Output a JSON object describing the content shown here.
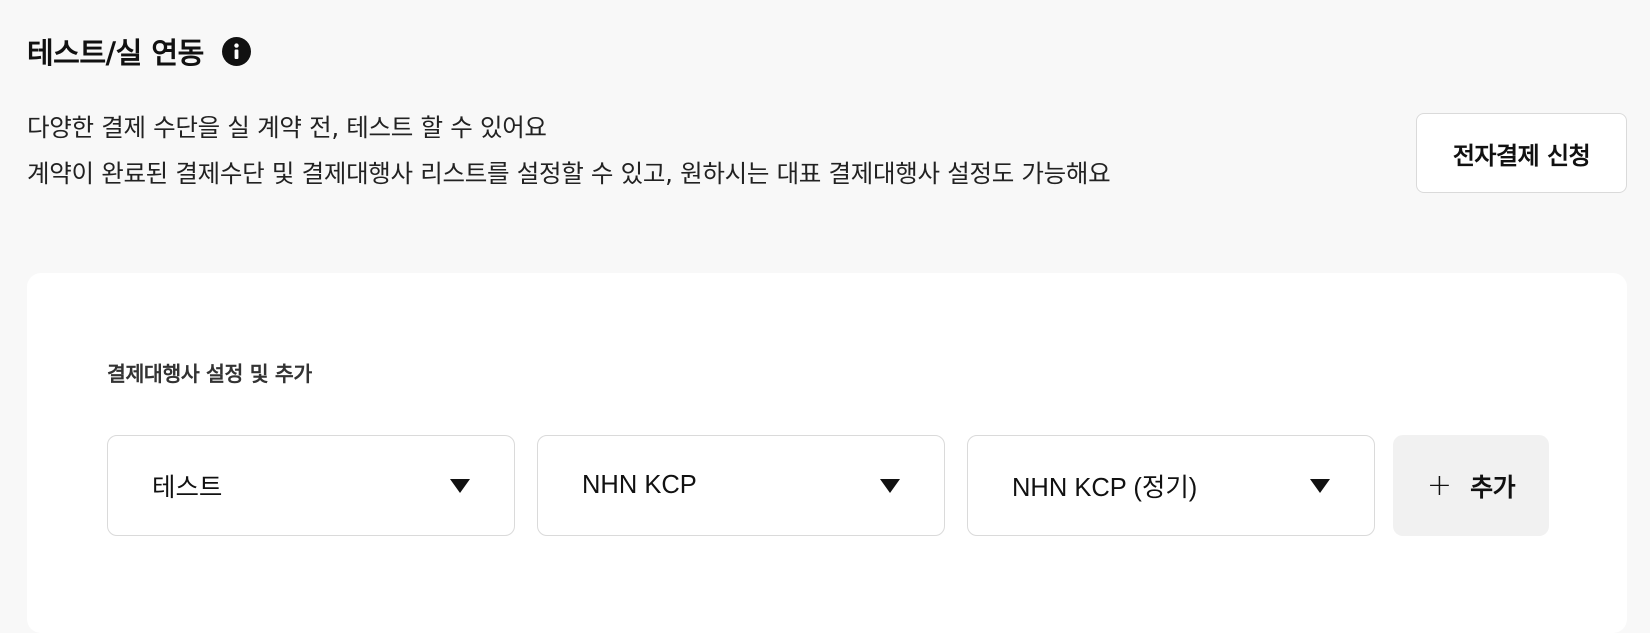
{
  "header": {
    "title": "테스트/실 연동",
    "info_icon": "info-icon"
  },
  "description": {
    "line1": "다양한 결제 수단을 실 계약 전, 테스트 할 수 있어요",
    "line2": "계약이 완료된 결제수단 및 결제대행사 리스트를 설정할 수 있고, 원하시는 대표 결제대행사 설정도 가능해요"
  },
  "apply_button": {
    "label": "전자결제 신청"
  },
  "pg_settings": {
    "section_label": "결제대행사 설정 및 추가",
    "selects": [
      {
        "value": "테스트",
        "icon": "caret-down-icon"
      },
      {
        "value": "NHN KCP",
        "icon": "caret-down-icon"
      },
      {
        "value": "NHN KCP (정기)",
        "icon": "caret-down-icon"
      }
    ],
    "add_button": {
      "icon": "plus-icon",
      "symbol": "+",
      "label": "추가"
    }
  }
}
